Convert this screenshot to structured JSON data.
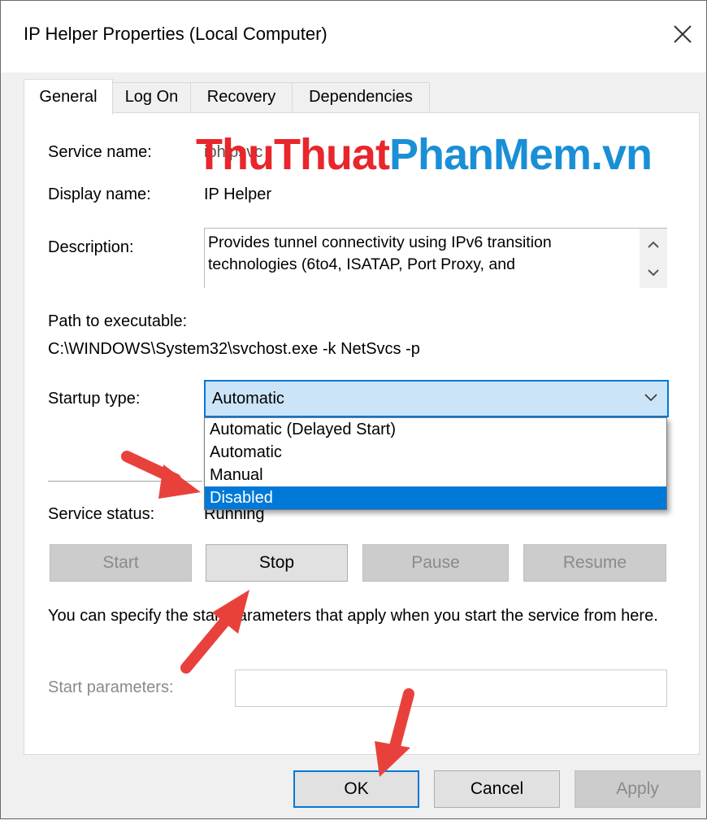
{
  "window": {
    "title": "IP Helper Properties (Local Computer)",
    "close_icon": "close-icon"
  },
  "tabs": [
    {
      "label": "General",
      "active": true
    },
    {
      "label": "Log On",
      "active": false
    },
    {
      "label": "Recovery",
      "active": false
    },
    {
      "label": "Dependencies",
      "active": false
    }
  ],
  "general": {
    "service_name_label": "Service name:",
    "service_name_value": "iphlpsvc",
    "display_name_label": "Display name:",
    "display_name_value": "IP Helper",
    "description_label": "Description:",
    "description_text": "Provides tunnel connectivity using IPv6 transition technologies (6to4, ISATAP, Port Proxy, and",
    "path_label": "Path to executable:",
    "path_value": "C:\\WINDOWS\\System32\\svchost.exe -k NetSvcs -p",
    "startup_type_label": "Startup type:",
    "startup_type_value": "Automatic",
    "startup_options": [
      "Automatic (Delayed Start)",
      "Automatic",
      "Manual",
      "Disabled"
    ],
    "startup_highlighted": "Disabled",
    "service_status_label": "Service status:",
    "service_status_value": "Running",
    "buttons": {
      "start": "Start",
      "stop": "Stop",
      "pause": "Pause",
      "resume": "Resume"
    },
    "hint_text": "You can specify the start parameters that apply when you start the service from here.",
    "start_params_label": "Start parameters:",
    "start_params_value": ""
  },
  "footer": {
    "ok": "OK",
    "cancel": "Cancel",
    "apply": "Apply"
  },
  "watermark": {
    "part1": "ThuThuat",
    "part2": "PhanMem",
    "part3": ".vn",
    "color1": "#e8262b",
    "color2": "#1a8fd6"
  },
  "colors": {
    "accent": "#0078d7",
    "annotation_arrow": "#e8413c"
  }
}
